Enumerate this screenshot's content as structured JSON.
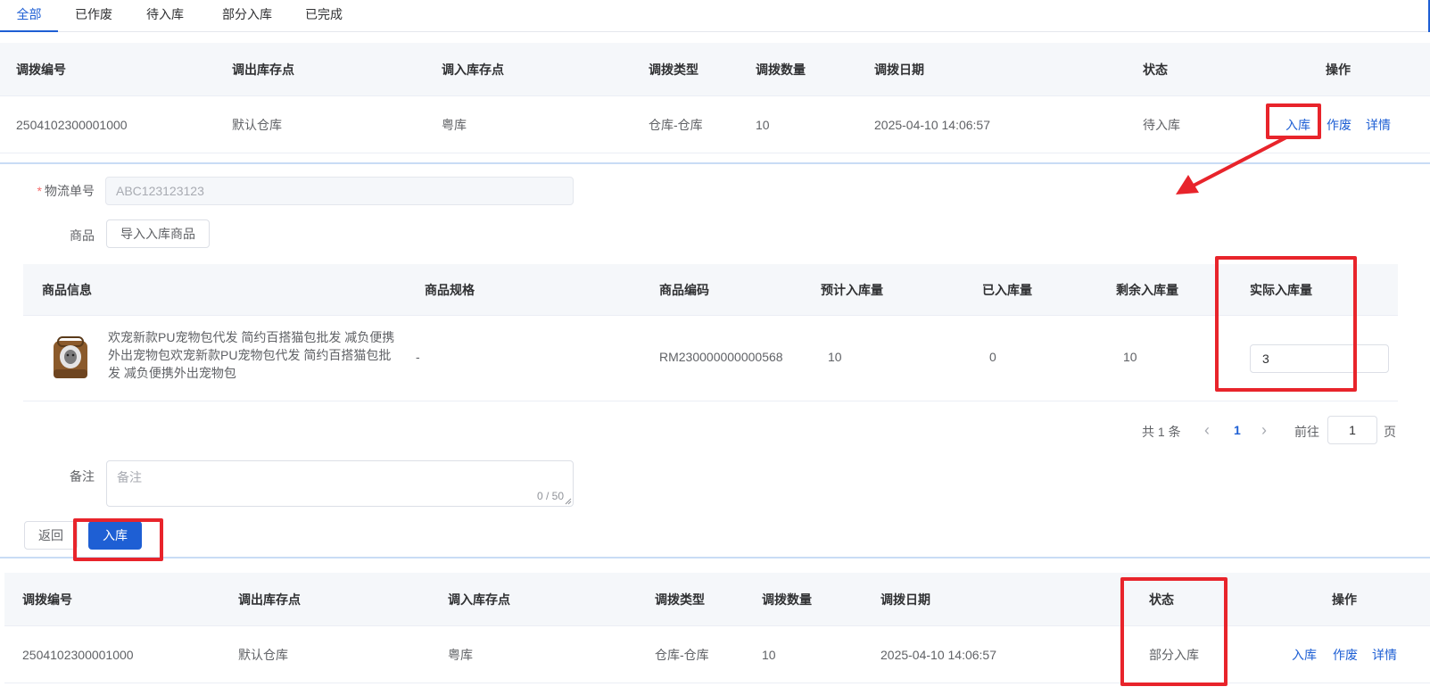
{
  "tabs": [
    "全部",
    "已作废",
    "待入库",
    "部分入库",
    "已完成"
  ],
  "table_headers": [
    "调拨编号",
    "调出库存点",
    "调入库存点",
    "调拨类型",
    "调拨数量",
    "调拨日期",
    "状态",
    "操作"
  ],
  "top_row": {
    "id": "2504102300001000",
    "from": "默认仓库",
    "to": "粤库",
    "type": "仓库-仓库",
    "qty": "10",
    "date": "2025-04-10 14:06:57",
    "status": "待入库",
    "actions": [
      "入库",
      "作废",
      "详情"
    ]
  },
  "form": {
    "logistics_label": "物流单号",
    "logistics_value": "ABC123123123",
    "goods_label": "商品",
    "import_button": "导入入库商品",
    "goods_headers": [
      "商品信息",
      "商品规格",
      "商品编码",
      "预计入库量",
      "已入库量",
      "剩余入库量",
      "实际入库量"
    ],
    "goods_row": {
      "name": "欢宠新款PU宠物包代发 简约百搭猫包批发 减负便携外出宠物包欢宠新款PU宠物包代发 简约百搭猫包批发 减负便携外出宠物包",
      "spec": "-",
      "code": "RM230000000000568",
      "expected": "10",
      "received": "0",
      "remaining": "10",
      "actual": "3"
    },
    "pagination": {
      "total": "共 1 条",
      "prev": "‹",
      "page": "1",
      "next": "›",
      "goto": "前往",
      "goto_value": "1",
      "unit": "页"
    },
    "remark_label": "备注",
    "remark_placeholder": "备注",
    "remark_count": "0 / 50",
    "back_button": "返回",
    "submit_button": "入库"
  },
  "bottom_row": {
    "id": "2504102300001000",
    "from": "默认仓库",
    "to": "粤库",
    "type": "仓库-仓库",
    "qty": "10",
    "date": "2025-04-10 14:06:57",
    "status": "部分入库",
    "actions": [
      "入库",
      "作废",
      "详情"
    ]
  },
  "colors": {
    "accent": "#1e5fd4",
    "highlight": "#e8242b",
    "header_bg": "#f5f7fa"
  }
}
